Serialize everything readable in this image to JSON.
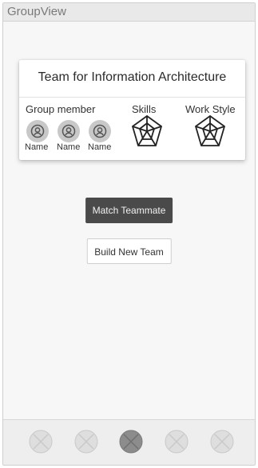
{
  "window": {
    "title": "GroupView"
  },
  "card": {
    "title": "Team for Information Architecture",
    "headers": {
      "members": "Group member",
      "skills": "Skills",
      "work_style": "Work Style"
    },
    "members": [
      {
        "name": "Name",
        "icon": "user-icon"
      },
      {
        "name": "Name",
        "icon": "user-icon"
      },
      {
        "name": "Name",
        "icon": "user-icon"
      }
    ],
    "charts": {
      "skills_icon": "radar-chart-icon",
      "work_style_icon": "radar-chart-icon"
    }
  },
  "actions": {
    "match_label": "Match Teammate",
    "build_label": "Build New Team"
  },
  "bottom_nav": {
    "items": [
      {
        "icon": "placeholder-icon",
        "selected": false
      },
      {
        "icon": "placeholder-icon",
        "selected": false
      },
      {
        "icon": "placeholder-icon",
        "selected": true
      },
      {
        "icon": "placeholder-icon",
        "selected": false
      },
      {
        "icon": "placeholder-icon",
        "selected": false
      }
    ]
  },
  "colors": {
    "primary_button": "#4a4a4a",
    "avatar": "#c8c8c8",
    "nav_selected": "#8c8c8c",
    "nav_idle": "#dedede"
  }
}
